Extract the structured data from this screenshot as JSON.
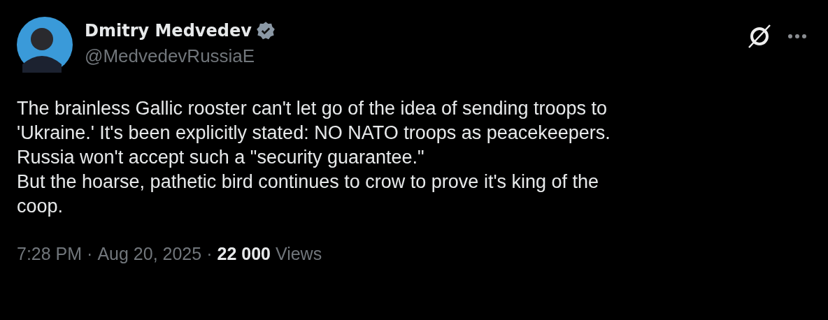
{
  "author": {
    "name": "Dmitry Medvedev",
    "verified": true,
    "handle": "@MedvedevRussiaE"
  },
  "body": {
    "lines": [
      "The brainless Gallic rooster can't let go of the idea of sending troops to",
      "'Ukraine.' It's been explicitly stated: NO NATO troops as peacekeepers.",
      "Russia won't accept such a \"security guarantee.\"",
      "But the hoarse, pathetic bird continues to crow to prove it's king of the",
      "coop."
    ]
  },
  "meta": {
    "time": "7:28 PM",
    "separator_1": "·",
    "date": "Aug 20, 2025",
    "separator_2": "·",
    "views_count": "22 000",
    "views_label": "Views"
  }
}
